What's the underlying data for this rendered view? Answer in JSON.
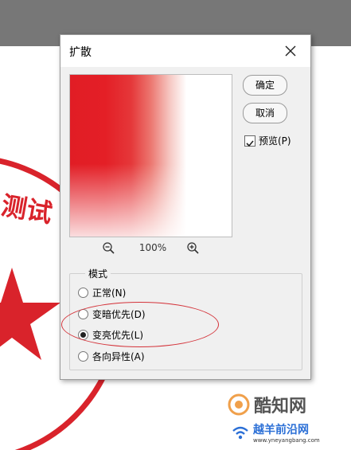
{
  "dialog": {
    "title": "扩散",
    "ok_label": "确定",
    "cancel_label": "取消",
    "preview_label": "预览(P)",
    "preview_checked": true,
    "zoom_text": "100%",
    "mode_group_label": "模式",
    "modes": [
      {
        "label": "正常(N)",
        "selected": false
      },
      {
        "label": "变暗优先(D)",
        "selected": false
      },
      {
        "label": "变亮优先(L)",
        "selected": true
      },
      {
        "label": "各向异性(A)",
        "selected": false
      }
    ]
  },
  "document": {
    "seal_text": "测试",
    "seal_color": "#d9232b"
  },
  "watermark": {
    "brand": "酷知网",
    "site_name": "越羊前沿网",
    "url": "www.yneyangbang.com"
  },
  "colors": {
    "workspace": "#777777",
    "dialog_bg": "#f0f0f0",
    "annotation": "#d4333a"
  }
}
